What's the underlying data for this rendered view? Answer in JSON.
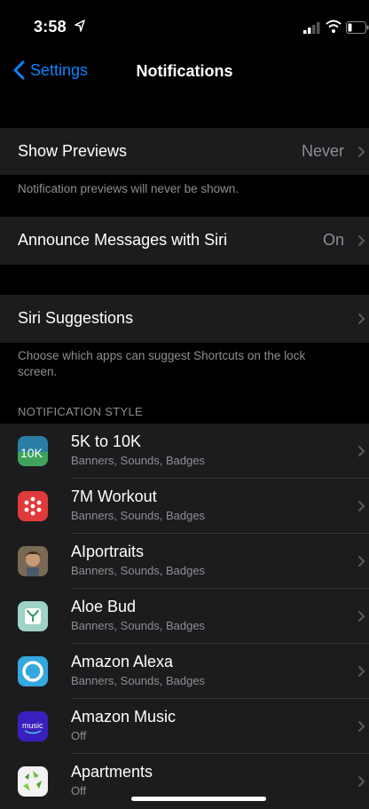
{
  "status": {
    "time": "3:58"
  },
  "nav": {
    "back_label": "Settings",
    "title": "Notifications"
  },
  "show_previews": {
    "label": "Show Previews",
    "value": "Never",
    "footer": "Notification previews will never be shown."
  },
  "announce": {
    "label": "Announce Messages with Siri",
    "value": "On"
  },
  "siri_suggestions": {
    "label": "Siri Suggestions",
    "footer": "Choose which apps can suggest Shortcuts on the lock screen."
  },
  "notification_style": {
    "header": "NOTIFICATION STYLE",
    "apps": [
      {
        "name": "5K to 10K",
        "detail": "Banners, Sounds, Badges",
        "icon": "5k-to-10k-icon"
      },
      {
        "name": "7M Workout",
        "detail": "Banners, Sounds, Badges",
        "icon": "7m-workout-icon"
      },
      {
        "name": "AIportraits",
        "detail": "Banners, Sounds, Badges",
        "icon": "aiportraits-icon"
      },
      {
        "name": "Aloe Bud",
        "detail": "Banners, Sounds, Badges",
        "icon": "aloe-bud-icon"
      },
      {
        "name": "Amazon Alexa",
        "detail": "Banners, Sounds, Badges",
        "icon": "amazon-alexa-icon"
      },
      {
        "name": "Amazon Music",
        "detail": "Off",
        "icon": "amazon-music-icon"
      },
      {
        "name": "Apartments",
        "detail": "Off",
        "icon": "apartments-icon"
      }
    ]
  },
  "colors": {
    "accent": "#0a84ff",
    "cell_bg": "#1c1c1e",
    "secondary_text": "#8e8e93"
  }
}
